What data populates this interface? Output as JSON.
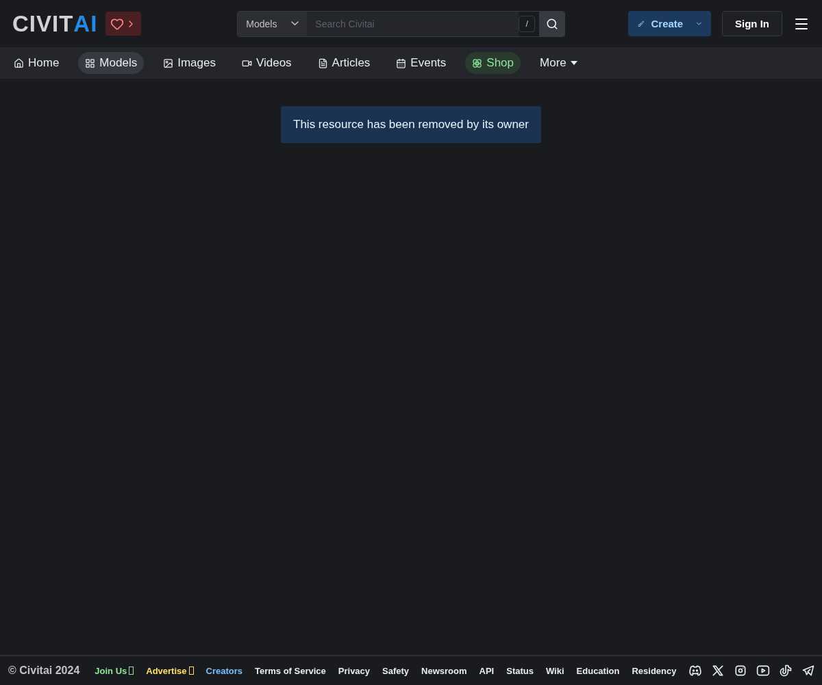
{
  "header": {
    "logo": [
      "CIVIT",
      "AI"
    ],
    "search": {
      "scope": "Models",
      "placeholder": "Search Civitai",
      "shortcut": "/"
    },
    "create_button": "Create",
    "sign_in_button": "Sign In"
  },
  "nav": [
    {
      "label": "Home",
      "selected": false,
      "kind": "link"
    },
    {
      "label": "Models",
      "selected": true,
      "kind": "link"
    },
    {
      "label": "Images",
      "selected": false,
      "kind": "link"
    },
    {
      "label": "Videos",
      "selected": false,
      "kind": "link"
    },
    {
      "label": "Articles",
      "selected": false,
      "kind": "link"
    },
    {
      "label": "Events",
      "selected": false,
      "kind": "link"
    },
    {
      "label": "Shop",
      "selected": false,
      "kind": "accent"
    },
    {
      "label": "More",
      "selected": false,
      "kind": "menu"
    }
  ],
  "notice": "This resource has been removed by its owner",
  "footer": {
    "copyright": "© Civitai 2024",
    "links": [
      {
        "label": "Join Us",
        "color": "#8ce99a",
        "missing_glyph": true
      },
      {
        "label": "Advertise",
        "color": "#ffe066",
        "missing_glyph": true
      },
      {
        "label": "Creators",
        "color": "#74c0fc",
        "missing_glyph": false
      },
      {
        "label": "Terms of Service",
        "color": "#e9ecef",
        "missing_glyph": false
      },
      {
        "label": "Privacy",
        "color": "#e9ecef",
        "missing_glyph": false
      },
      {
        "label": "Safety",
        "color": "#e9ecef",
        "missing_glyph": false
      },
      {
        "label": "Newsroom",
        "color": "#e9ecef",
        "missing_glyph": false
      },
      {
        "label": "API",
        "color": "#e9ecef",
        "missing_glyph": false
      },
      {
        "label": "Status",
        "color": "#e9ecef",
        "missing_glyph": false
      },
      {
        "label": "Wiki",
        "color": "#e9ecef",
        "missing_glyph": false
      },
      {
        "label": "Education",
        "color": "#e9ecef",
        "missing_glyph": false
      },
      {
        "label": "Residency",
        "color": "#e9ecef",
        "missing_glyph": false
      }
    ]
  }
}
